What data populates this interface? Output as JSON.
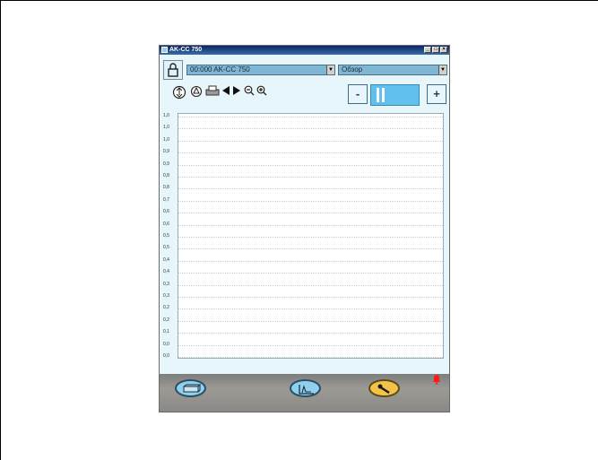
{
  "window": {
    "title": "AK-CC 750"
  },
  "controls": {
    "device_combo": "00:000 AK-CC 750",
    "view_combo": "Обзор",
    "pager_minus": "-",
    "pager_plus": "+"
  },
  "chart_data": {
    "type": "line",
    "series": [],
    "y_ticks": [
      "1,0",
      "1,0",
      "1,0",
      "0,9",
      "0,9",
      "0,8",
      "0,8",
      "0,7",
      "0,6",
      "0,6",
      "0,5",
      "0,5",
      "0,4",
      "0,4",
      "0,3",
      "0,3",
      "0,2",
      "0,2",
      "0,1",
      "0,0",
      "0,0"
    ],
    "grid": true
  },
  "colors": {
    "window_bg": "#e6f6fb",
    "combo_bg": "#7fb6d3",
    "pager_accent": "#62c1ec",
    "oval_blue": "#8fd0ee",
    "oval_gold": "#f2c349",
    "alarm_red": "#ff1a1a"
  },
  "icons": {
    "toolbar": [
      "refresh-icon",
      "sensor-icon",
      "print-icon",
      "scroll-left-icon",
      "scroll-right-icon",
      "zoom-out-icon",
      "zoom-in-icon"
    ],
    "bottom": [
      "device-icon",
      "graph-icon",
      "service-icon",
      "alarm-bell-icon"
    ]
  }
}
